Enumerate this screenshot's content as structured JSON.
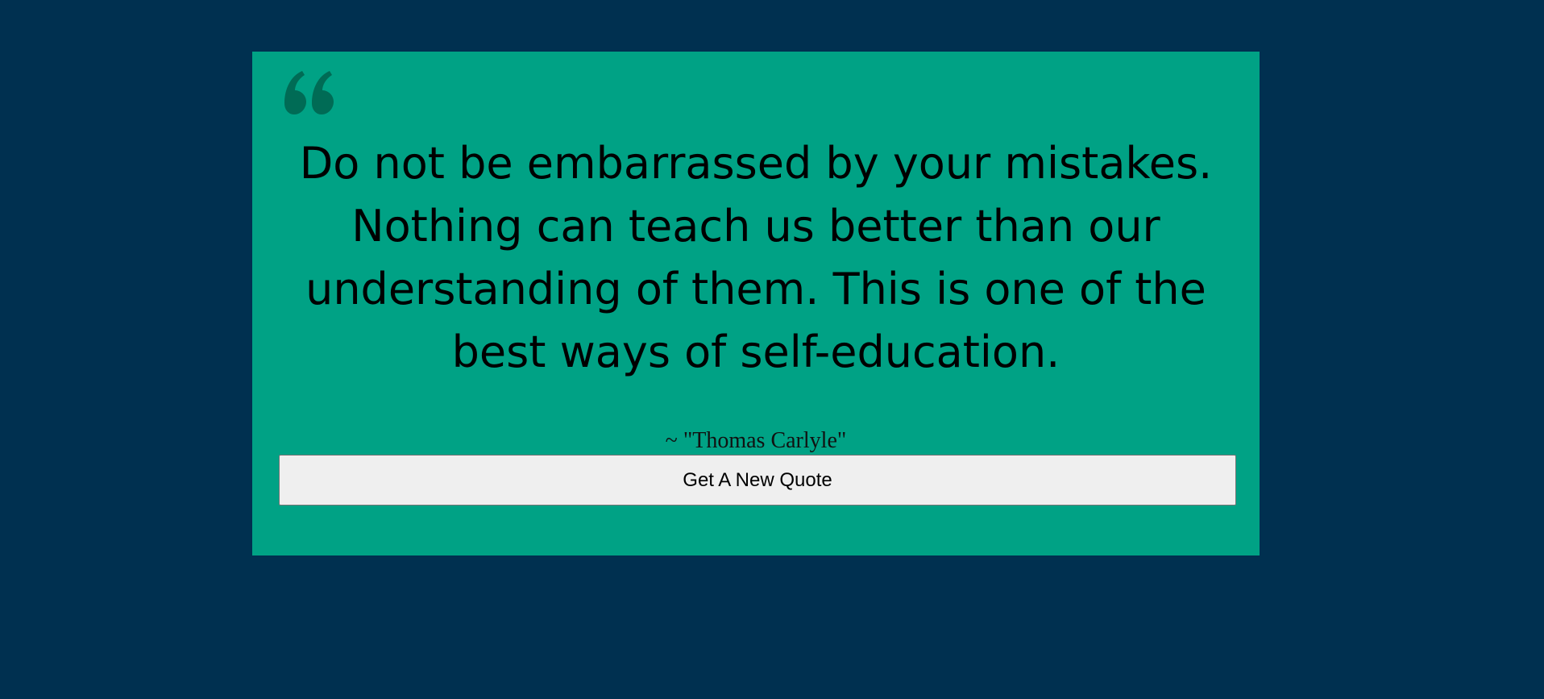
{
  "colors": {
    "background": "#003050",
    "card": "#00a285",
    "quote_icon": "#006b55",
    "button": "#efefef"
  },
  "quote": {
    "icon": "quote-left-icon",
    "text": "Do not be embarrassed by your mistakes. Nothing can teach us better than our understanding of them. This is one of the best ways of self-education.",
    "author": "~ \"Thomas Carlyle\""
  },
  "actions": {
    "new_quote_label": "Get A New Quote"
  }
}
